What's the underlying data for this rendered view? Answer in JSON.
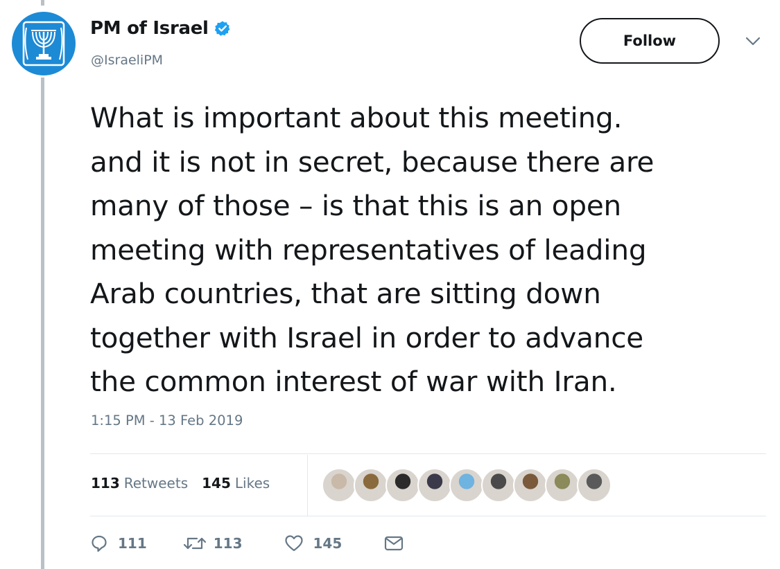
{
  "author": {
    "name": "PM of Israel",
    "handle": "@IsraeliPM"
  },
  "follow_label": "Follow",
  "tweet": {
    "lines": [
      "What is important about this meeting.",
      "and it is not in secret, because there are",
      "many of those – is that this is an open",
      "meeting with representatives of leading",
      "Arab countries, that are sitting down",
      "together with Israel in order to advance",
      "the common interest of war with Iran."
    ],
    "timestamp": "1:15 PM - 13 Feb 2019"
  },
  "stats": {
    "retweets_count": "113",
    "retweets_label": "Retweets",
    "likes_count": "145",
    "likes_label": "Likes"
  },
  "actions": {
    "replies": "111",
    "retweets": "113",
    "likes": "145"
  },
  "colors": {
    "verified": "#1da1f2",
    "avatar_bg": "#1d8ad6",
    "muted": "#657786"
  },
  "likers": [
    {
      "icon": "liker-avatar-1",
      "color": "#c9b9a8"
    },
    {
      "icon": "liker-avatar-2",
      "color": "#8a6a3c"
    },
    {
      "icon": "liker-avatar-3",
      "color": "#2b2b2b"
    },
    {
      "icon": "liker-avatar-4",
      "color": "#3a3a4a"
    },
    {
      "icon": "liker-avatar-5",
      "color": "#6fb3e0"
    },
    {
      "icon": "liker-avatar-6",
      "color": "#4a4a4a"
    },
    {
      "icon": "liker-avatar-7",
      "color": "#7a5a3a"
    },
    {
      "icon": "liker-avatar-8",
      "color": "#8a8a5a"
    },
    {
      "icon": "liker-avatar-9",
      "color": "#5a5a5a"
    }
  ]
}
